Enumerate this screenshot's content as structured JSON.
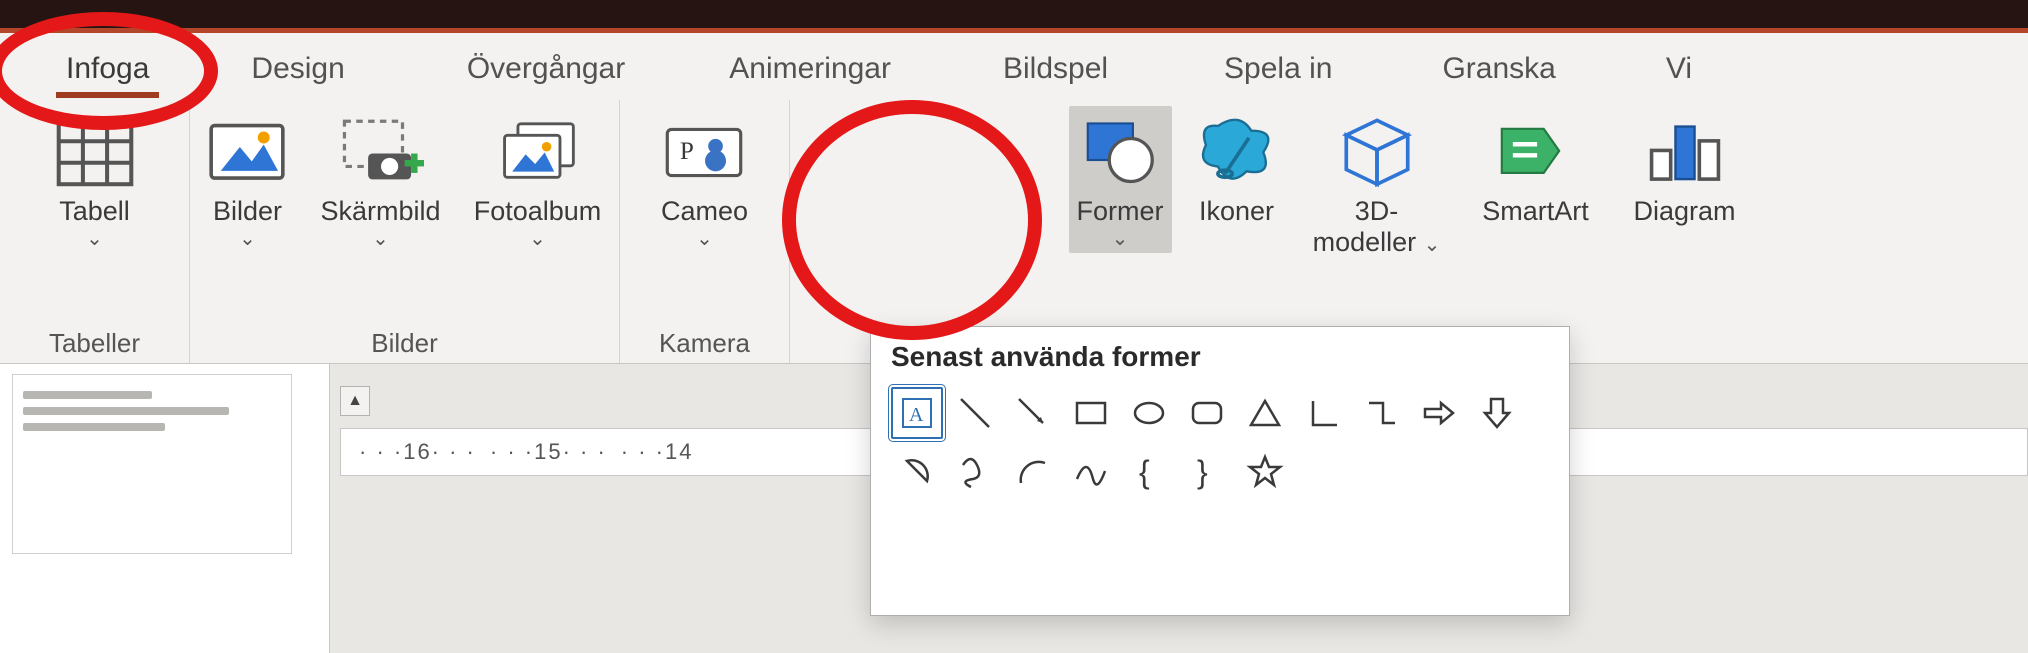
{
  "tabs": {
    "active": "Infoga",
    "items": [
      "Infoga",
      "Design",
      "Övergångar",
      "Animeringar",
      "Bildspel",
      "Spela in",
      "Granska",
      "Vi"
    ]
  },
  "ribbon": {
    "groups": {
      "tables": {
        "label": "Tabeller",
        "buttons": {
          "table": {
            "label": "Tabell"
          }
        }
      },
      "images": {
        "label": "Bilder",
        "buttons": {
          "pictures": {
            "label": "Bilder"
          },
          "screenshot": {
            "label": "Skärmbild"
          },
          "photoalbum": {
            "label": "Fotoalbum"
          }
        }
      },
      "camera": {
        "label": "Kamera",
        "buttons": {
          "cameo": {
            "label": "Cameo"
          }
        }
      },
      "illus": {
        "label": "",
        "buttons": {
          "shapes": {
            "label": "Former"
          },
          "icons": {
            "label": "Ikoner"
          },
          "models3d": {
            "label": "3D-",
            "label2": "modeller"
          },
          "smartart": {
            "label": "SmartArt"
          },
          "chart": {
            "label": "Diagram"
          }
        }
      }
    }
  },
  "ruler": {
    "segments": [
      "· · ·16· · ·",
      "· · ·15· · ·",
      "· · ·14"
    ]
  },
  "shapesDropdown": {
    "header": "Senast använda former",
    "shapes": [
      "text-box",
      "line",
      "line-arrow",
      "rectangle",
      "oval",
      "rounded-rectangle",
      "triangle",
      "right-angle",
      "elbow-connector",
      "right-arrow",
      "down-arrow",
      "chord",
      "scribble",
      "arc",
      "curve",
      "left-brace",
      "right-brace",
      "star"
    ]
  }
}
